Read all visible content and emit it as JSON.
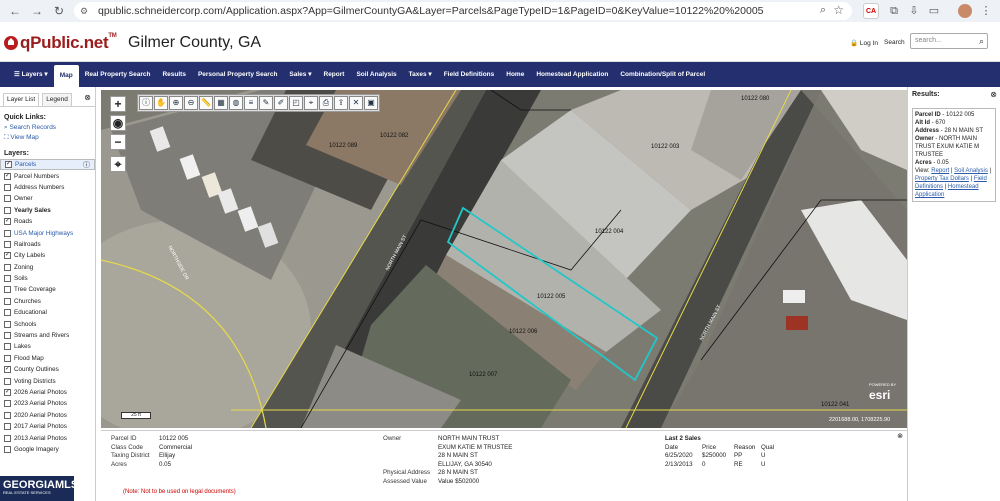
{
  "browser": {
    "url": "qpublic.schneidercorp.com/Application.aspx?App=GilmerCountyGA&Layer=Parcels&PageTypeID=1&PageID=0&KeyValue=10122%20%20005",
    "ext_label": "CA"
  },
  "header": {
    "logo": "qPublic.net",
    "logo_tm": "TM",
    "county": "Gilmer County, GA",
    "login": "Log In",
    "search_label": "Search",
    "search_placeholder": "search..."
  },
  "nav": {
    "items": [
      "Layers",
      "Map",
      "Real Property Search",
      "Results",
      "Personal Property Search",
      "Sales",
      "Report",
      "Soil Analysis",
      "Taxes",
      "Field Definitions",
      "Home",
      "Homestead Application",
      "Combination/Split of Parcel"
    ],
    "active": "Map"
  },
  "left_panel": {
    "tabs": [
      "Layer List",
      "Legend"
    ],
    "quick_links_title": "Quick Links:",
    "quick_links": [
      "Search Records",
      "View Map"
    ],
    "layers_title": "Layers:",
    "layers": [
      {
        "label": "Parcels",
        "checked": true,
        "style": "link",
        "selected": true
      },
      {
        "label": "Parcel Numbers",
        "checked": true,
        "style": "normal"
      },
      {
        "label": "Address Numbers",
        "checked": false,
        "style": "normal"
      },
      {
        "label": "Owner",
        "checked": false,
        "style": "normal"
      },
      {
        "label": "Yearly Sales",
        "checked": false,
        "style": "bold"
      },
      {
        "label": "Roads",
        "checked": true,
        "style": "normal"
      },
      {
        "label": "USA Major Highways",
        "checked": false,
        "style": "link"
      },
      {
        "label": "Railroads",
        "checked": false,
        "style": "normal"
      },
      {
        "label": "City Labels",
        "checked": true,
        "style": "normal"
      },
      {
        "label": "Zoning",
        "checked": false,
        "style": "normal"
      },
      {
        "label": "Soils",
        "checked": false,
        "style": "normal"
      },
      {
        "label": "Tree Coverage",
        "checked": false,
        "style": "normal"
      },
      {
        "label": "Churches",
        "checked": false,
        "style": "normal"
      },
      {
        "label": "Educational",
        "checked": false,
        "style": "normal"
      },
      {
        "label": "Schools",
        "checked": false,
        "style": "normal"
      },
      {
        "label": "Streams and Rivers",
        "checked": false,
        "style": "normal"
      },
      {
        "label": "Lakes",
        "checked": false,
        "style": "normal"
      },
      {
        "label": "Flood Map",
        "checked": false,
        "style": "normal"
      },
      {
        "label": "County Outlines",
        "checked": true,
        "style": "normal"
      },
      {
        "label": "Voting Districts",
        "checked": false,
        "style": "normal"
      },
      {
        "label": "2026 Aerial Photos",
        "checked": true,
        "style": "normal"
      },
      {
        "label": "2023 Aerial Photos",
        "checked": false,
        "style": "normal"
      },
      {
        "label": "2020 Aerial Photos",
        "checked": false,
        "style": "normal"
      },
      {
        "label": "2017 Aerial Photos",
        "checked": false,
        "style": "normal"
      },
      {
        "label": "2013 Aerial Photos",
        "checked": false,
        "style": "normal"
      },
      {
        "label": "Google Imagery",
        "checked": false,
        "style": "normal"
      }
    ]
  },
  "map": {
    "parcel_labels": [
      {
        "text": "10122 080"
      },
      {
        "text": "10122 089"
      },
      {
        "text": "10122 082"
      },
      {
        "text": "10122 003"
      },
      {
        "text": "10122 004"
      },
      {
        "text": "10122 005"
      },
      {
        "text": "10122 006"
      },
      {
        "text": "10122 007"
      },
      {
        "text": "10122 041"
      }
    ],
    "street_labels": [
      "NORTH MAIN ST",
      "NORTH MAIN ST",
      "NORTHSIDE DR"
    ],
    "scale": "25 ft",
    "powered_by": "POWERED BY",
    "esri": "esri",
    "coords": "2201688.00, 1708225.90"
  },
  "results": {
    "title": "Results:",
    "parcel_id_label": "Parcel ID",
    "parcel_id": "10122 005",
    "alt_id_label": "Alt Id",
    "alt_id": "670",
    "address_label": "Address",
    "address": "28 N MAIN ST",
    "owner_label": "Owner",
    "owner": "NORTH MAIN TRUST EXUM KATIE M TRUSTEE",
    "acres_label": "Acres",
    "acres": "0.05",
    "view_label": "View:",
    "links": [
      "Report",
      "Soil Analysis",
      "Property Tax Dollars",
      "Field Definitions",
      "Homestead Application"
    ]
  },
  "info": {
    "left": [
      {
        "k": "Parcel ID",
        "v": "10122 005"
      },
      {
        "k": "Class Code",
        "v": "Commercial"
      },
      {
        "k": "Taxing District",
        "v": "Ellijay"
      },
      {
        "k": "Acres",
        "v": "0.05"
      }
    ],
    "owner_label": "Owner",
    "owner_lines": [
      "NORTH MAIN TRUST",
      "EXUM KATIE M TRUSTEE",
      "28 N MAIN ST",
      "ELLIJAY, GA 30540"
    ],
    "phys_label": "Physical Address",
    "phys": "28 N MAIN ST",
    "assessed_label": "Assessed Value",
    "assessed": "Value $502000",
    "sales_title": "Last 2 Sales",
    "sales_headers": [
      "Date",
      "Price",
      "Reason",
      "Qual"
    ],
    "sales": [
      [
        "6/25/2020",
        "$250000",
        "PP",
        "U"
      ],
      [
        "2/13/2013",
        "0",
        "RE",
        "U"
      ]
    ],
    "note": "(Note: Not to be used on legal documents)"
  },
  "watermark": {
    "title": "GEORGIAMLS",
    "sub": "REAL ESTATE SERVICES"
  }
}
